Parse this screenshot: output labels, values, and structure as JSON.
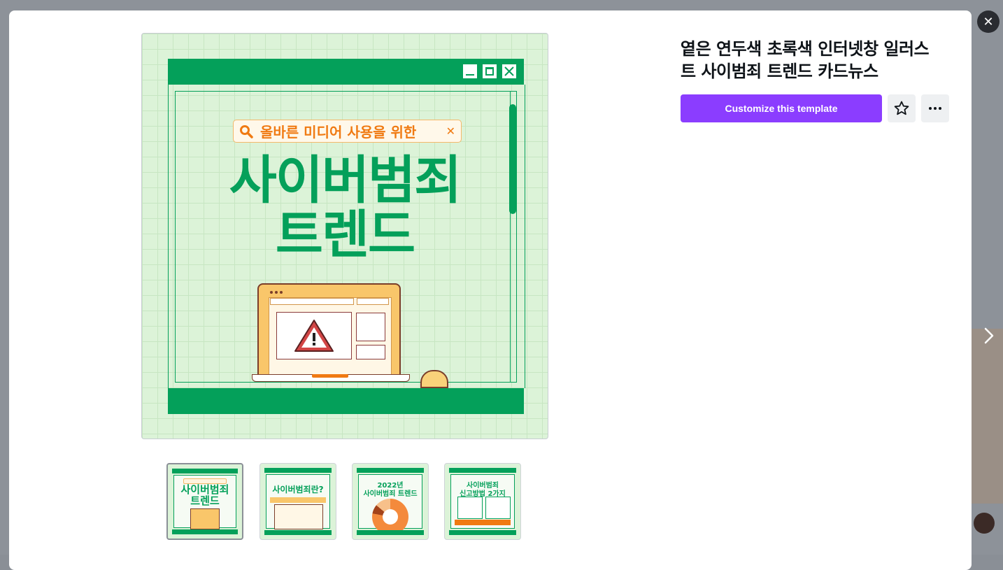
{
  "template": {
    "title": "옅은 연두색 초록색 인터넷창 일러스트 사이범죄 트렌드 카드뉴스",
    "title_line1": "옅은 연두색 초록색 인터넷창 일러스",
    "title_line2": "트 사이범죄 트렌드 카드뉴스"
  },
  "actions": {
    "customize_label": "Customize this template",
    "favorite_icon": "star-icon",
    "more_icon": "more-horizontal-icon"
  },
  "controls": {
    "close_icon": "close-icon",
    "close_glyph": "✕",
    "next_icon": "chevron-right-icon"
  },
  "preview": {
    "search_text": "올바른 미디어 사용을 위한",
    "search_close": "✕",
    "headline_line1": "사이버범죄",
    "headline_line2": "트렌드"
  },
  "thumbnails": [
    {
      "label_line1": "사이버범죄",
      "label_line2": "트렌드",
      "active": true
    },
    {
      "label_line1": "사이버범죄란?",
      "label_line2": "",
      "active": false
    },
    {
      "label_line1": "2022년",
      "label_line2": "사이버범죄 트렌드",
      "active": false
    },
    {
      "label_line1": "사이버범죄",
      "label_line2": "신고방법 2가지",
      "active": false
    }
  ],
  "colors": {
    "brand_purple": "#8b3dff",
    "green": "#04a05a",
    "mint_bg": "#dcf3d8",
    "orange": "#f07a12"
  }
}
